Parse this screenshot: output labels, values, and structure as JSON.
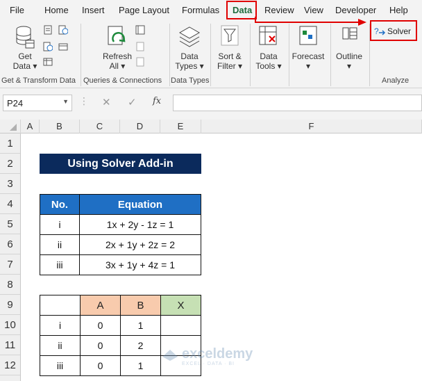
{
  "menu": {
    "items": [
      "File",
      "Home",
      "Insert",
      "Page Layout",
      "Formulas",
      "Data",
      "Review",
      "View",
      "Developer",
      "Help"
    ],
    "active": "Data"
  },
  "ribbon": {
    "get_data": {
      "line1": "Get",
      "line2": "Data ▾"
    },
    "refresh_all": {
      "line1": "Refresh",
      "line2": "All ▾"
    },
    "data_types": {
      "line1": "Data",
      "line2": "Types ▾"
    },
    "sort_filter": {
      "line1": "Sort &",
      "line2": "Filter ▾"
    },
    "data_tools": {
      "line1": "Data",
      "line2": "Tools ▾"
    },
    "forecast": {
      "line1": "Forecast",
      "line2": "▾"
    },
    "outline": {
      "line1": "Outline",
      "line2": "▾"
    },
    "solver": "Solver",
    "groups": {
      "get_transform": "Get & Transform Data",
      "queries": "Queries & Connections",
      "data_types": "Data Types",
      "analyze": "Analyze"
    }
  },
  "formula_bar": {
    "name_box": "P24",
    "cancel_icon": "✕",
    "enter_icon": "✓",
    "fx": "fx",
    "formula": ""
  },
  "columns": [
    "A",
    "B",
    "C",
    "D",
    "E",
    "F"
  ],
  "rows": [
    "1",
    "2",
    "3",
    "4",
    "5",
    "6",
    "7",
    "8",
    "9",
    "10",
    "11",
    "12"
  ],
  "sheet": {
    "title": "Using Solver Add-in",
    "equations": {
      "headers": {
        "no": "No.",
        "equation": "Equation"
      },
      "rows": [
        {
          "no": "i",
          "equation": "1x + 2y - 1z = 1"
        },
        {
          "no": "ii",
          "equation": "2x + 1y + 2z = 2"
        },
        {
          "no": "iii",
          "equation": "3x + 1y + 4z = 1"
        }
      ]
    },
    "matrix": {
      "headers": {
        "blank": "",
        "a": "A",
        "b": "B",
        "x": "X"
      },
      "rows": [
        {
          "label": "i",
          "a": "0",
          "b": "1",
          "x": ""
        },
        {
          "label": "ii",
          "a": "0",
          "b": "2",
          "x": ""
        },
        {
          "label": "iii",
          "a": "0",
          "b": "1",
          "x": ""
        }
      ]
    }
  },
  "watermark": {
    "name": "exceldemy",
    "tagline": "EXCEL · DATA · BI"
  },
  "colors": {
    "title_bg": "#0b2a5c",
    "header_blue": "#1f6fc4",
    "header_peach": "#f8cbad",
    "header_green": "#c6e0b4",
    "annotation_red": "#e00000",
    "excel_green": "#1e6b3c"
  }
}
